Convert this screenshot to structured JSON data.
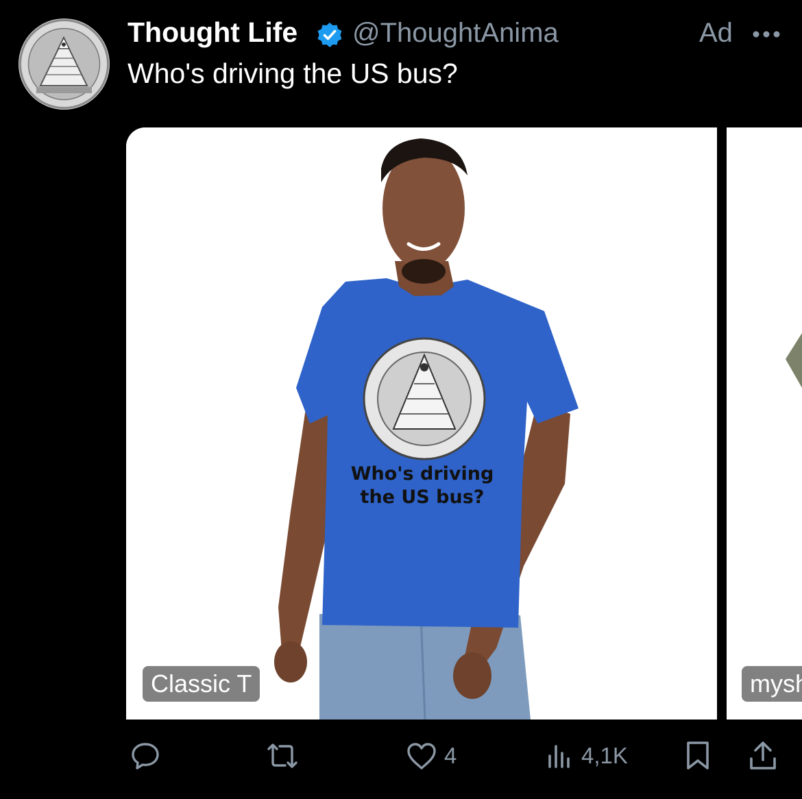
{
  "tweet": {
    "display_name": "Thought Life",
    "handle": "@ThoughtAnima",
    "ad_label": "Ad",
    "text": "Who's driving the US bus?",
    "verified_icon": "verified-badge-icon",
    "more_icon": "more-dots-icon"
  },
  "cards": [
    {
      "label": "Classic T",
      "shirt_text_line1": "Who's driving",
      "shirt_text_line2": "the US bus?",
      "shirt_color": "#2f63c9"
    },
    {
      "label": "mysh"
    }
  ],
  "actions": {
    "reply_icon": "reply-bubble-icon",
    "repost_icon": "repost-icon",
    "like_icon": "heart-icon",
    "likes": "4",
    "views_icon": "views-bar-chart-icon",
    "views": "4,1K",
    "bookmark_icon": "bookmark-icon",
    "share_icon": "share-icon"
  },
  "colors": {
    "verified": "#1d9bf0",
    "muted": "#8b98a5",
    "background": "#000000"
  }
}
